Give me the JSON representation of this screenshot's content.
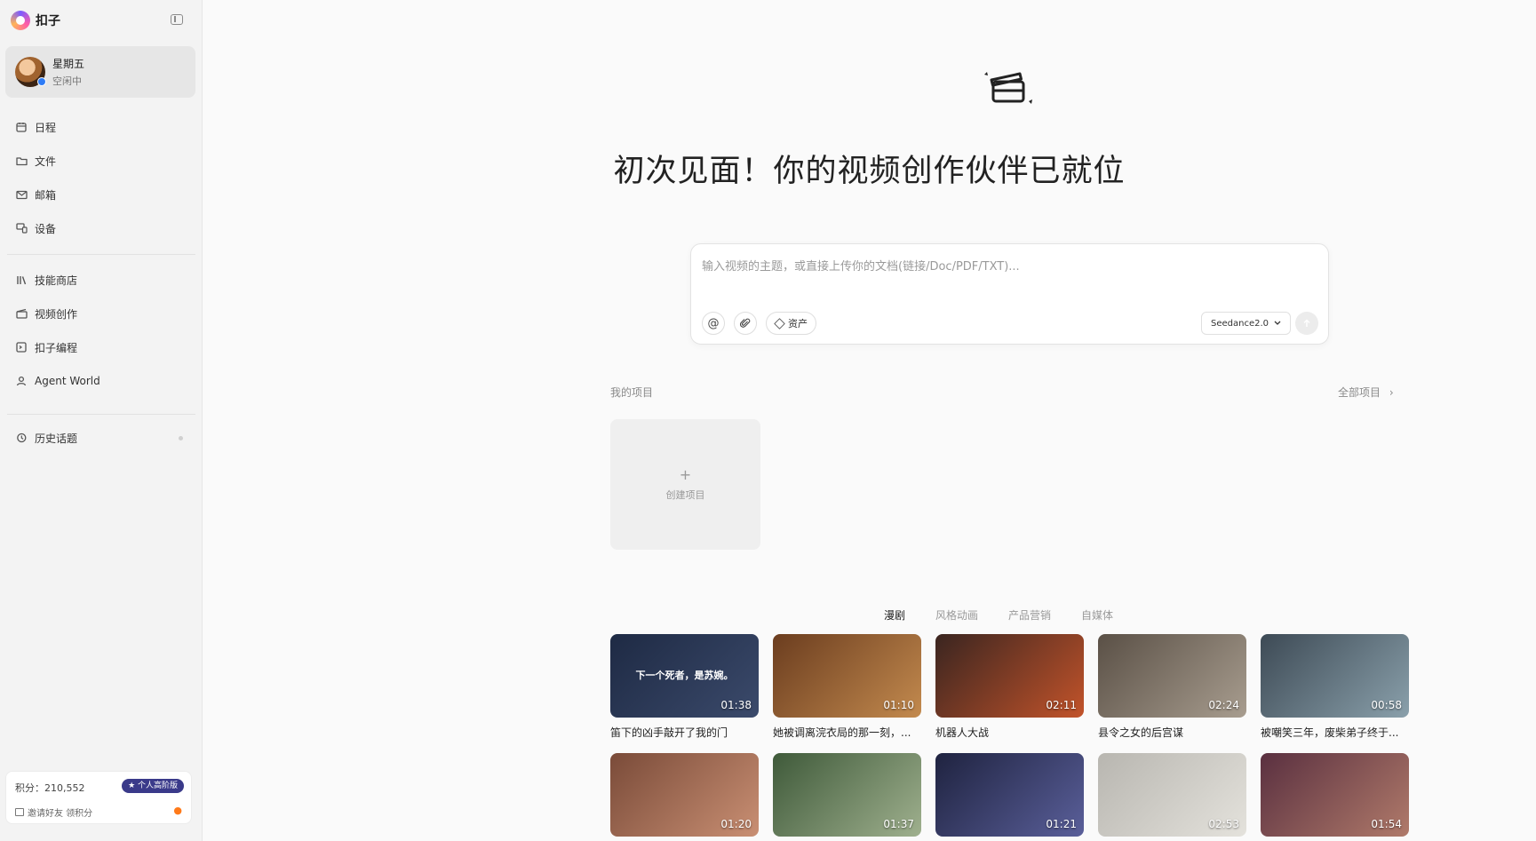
{
  "app": {
    "name": "扣子"
  },
  "user": {
    "name": "星期五",
    "status": "空闲中"
  },
  "nav": {
    "group1": [
      {
        "label": "日程",
        "icon": "calendar-icon"
      },
      {
        "label": "文件",
        "icon": "folder-icon"
      },
      {
        "label": "邮箱",
        "icon": "mail-icon"
      },
      {
        "label": "设备",
        "icon": "device-icon"
      }
    ],
    "group2": [
      {
        "label": "技能商店",
        "icon": "library-icon"
      },
      {
        "label": "视频创作",
        "icon": "clapper-icon"
      },
      {
        "label": "扣子编程",
        "icon": "code-icon"
      },
      {
        "label": "Agent World",
        "icon": "person-icon"
      }
    ],
    "history": {
      "label": "历史话题",
      "icon": "history-icon"
    }
  },
  "points": {
    "text": "积分：210,552",
    "plan": "★ 个人高阶版",
    "invite": "邀请好友 领积分"
  },
  "main": {
    "headline": "初次见面！你的视频创作伙伴已就位",
    "prompt": {
      "placeholder": "输入视频的主题，或直接上传你的文档(链接/Doc/PDF/TXT)...",
      "mention_icon": "@",
      "assets_label": "资产",
      "model": "Seedance2.0"
    },
    "projects": {
      "title": "我的项目",
      "all_label": "全部项目",
      "create_plus": "+",
      "create_label": "创建项目"
    },
    "tabs": [
      "漫剧",
      "风格动画",
      "产品营销",
      "自媒体"
    ],
    "active_tab": "漫剧",
    "cards": [
      {
        "title": "笛下的凶手敲开了我的门",
        "duration": "01:38",
        "overlay": "下一个死者，是苏婉。",
        "colors": [
          "#1e2a44",
          "#3b4a6b"
        ]
      },
      {
        "title": "她被调离浣衣局的那一刻，...",
        "duration": "01:10",
        "overlay": "",
        "colors": [
          "#6b3d1f",
          "#c38a4e"
        ]
      },
      {
        "title": "机器人大战",
        "duration": "02:11",
        "overlay": "",
        "colors": [
          "#3a2520",
          "#c2532a"
        ]
      },
      {
        "title": "县令之女的后宫谋",
        "duration": "02:24",
        "overlay": "",
        "colors": [
          "#5a5046",
          "#a89d8f"
        ]
      },
      {
        "title": "被嘲笑三年，废柴弟子终于...",
        "duration": "00:58",
        "overlay": "",
        "colors": [
          "#3d4a55",
          "#8aa0ab"
        ]
      },
      {
        "title": "",
        "duration": "01:20",
        "overlay": "",
        "colors": [
          "#7a4b39",
          "#c98f73"
        ]
      },
      {
        "title": "",
        "duration": "01:37",
        "overlay": "",
        "colors": [
          "#3f5a3a",
          "#9fb08e"
        ]
      },
      {
        "title": "",
        "duration": "01:21",
        "overlay": "",
        "colors": [
          "#1f2340",
          "#5a5f9a"
        ]
      },
      {
        "title": "",
        "duration": "02:53",
        "overlay": "",
        "colors": [
          "#b8b6b0",
          "#e4e2dc"
        ]
      },
      {
        "title": "",
        "duration": "01:54",
        "overlay": "",
        "colors": [
          "#5a3040",
          "#b07a6a"
        ]
      }
    ]
  }
}
